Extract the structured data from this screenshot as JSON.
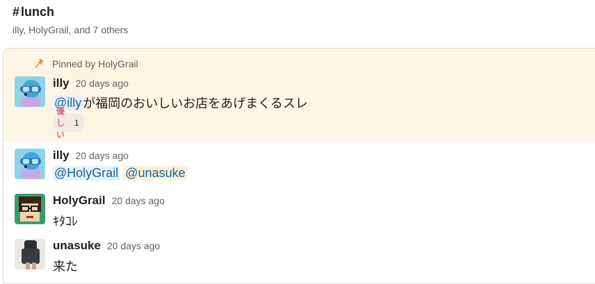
{
  "channel": {
    "hash": "#",
    "name": "lunch",
    "members": "illy, HolyGrail, and 7 others"
  },
  "pinned": {
    "label": "Pinned by HolyGrail",
    "pin_color": "#e8912d"
  },
  "messages": [
    {
      "author": "illy",
      "time": "20 days ago",
      "mention": "@illy",
      "text": " が福岡のおいしいお店をあげまくるスレ",
      "reaction": {
        "emoji_text": "優しい",
        "count": "1"
      }
    },
    {
      "author": "illy",
      "time": "20 days ago",
      "mentions": [
        "@HolyGrail",
        "@unasuke"
      ]
    },
    {
      "author": "HolyGrail",
      "time": "20 days ago",
      "text": "ｷﾀｺﾚ"
    },
    {
      "author": "unasuke",
      "time": "20 days ago",
      "text": "来た"
    }
  ],
  "colors": {
    "pinned_bg": "#fdf5e6",
    "mention_bg": "#e8f1f8",
    "mention_text": "#1264a3"
  }
}
